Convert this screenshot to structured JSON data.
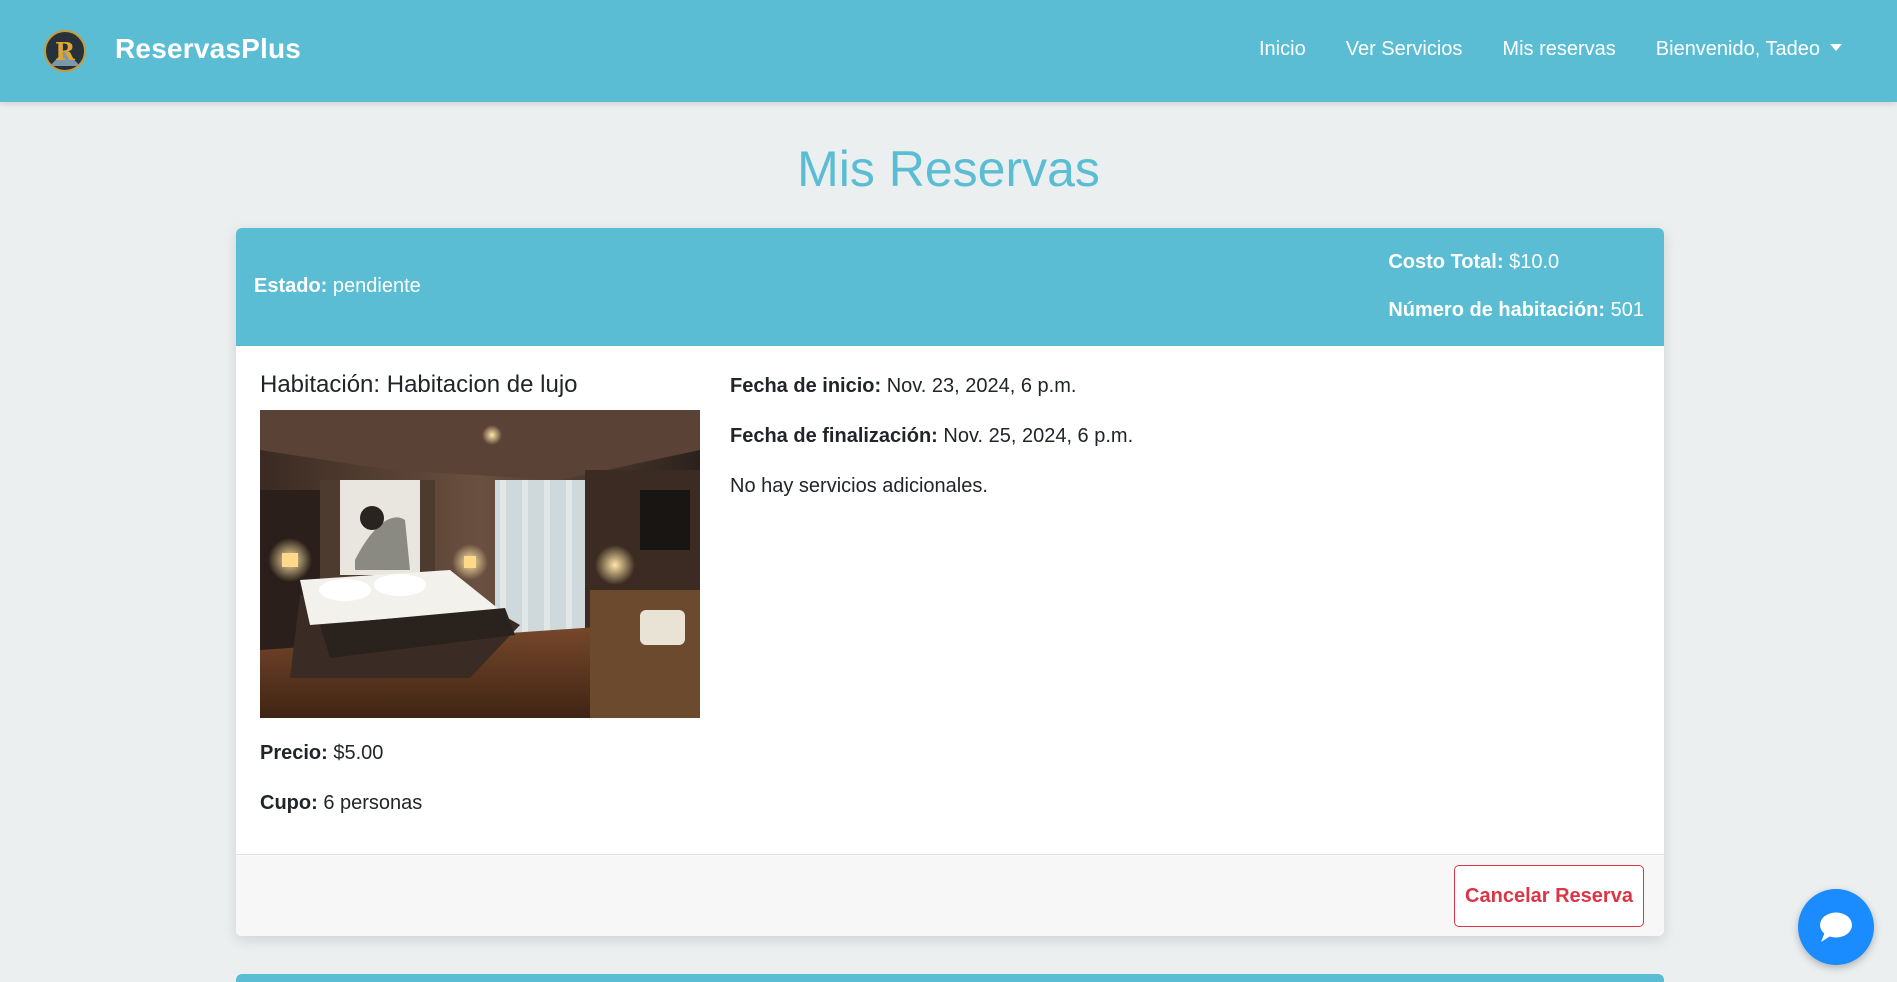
{
  "navbar": {
    "brand": "ReservasPlus",
    "logo_letter": "R",
    "links": [
      "Inicio",
      "Ver Servicios",
      "Mis reservas"
    ],
    "user_menu": "Bienvenido, Tadeo"
  },
  "page": {
    "title": "Mis Reservas"
  },
  "reservation": {
    "status_label": "Estado:",
    "status_value": "pendiente",
    "total_label": "Costo Total:",
    "total_value": "$10.0",
    "room_number_label": "Número de habitación:",
    "room_number_value": "501",
    "room_title": "Habitación: Habitacion de lujo",
    "price_label": "Precio:",
    "price_value": "$5.00",
    "capacity_label": "Cupo:",
    "capacity_value": "6 personas",
    "start_label": "Fecha de inicio:",
    "start_value": "Nov. 23, 2024, 6 p.m.",
    "end_label": "Fecha de finalización:",
    "end_value": "Nov. 25, 2024, 6 p.m.",
    "services_text": "No hay servicios adicionales.",
    "cancel_label": "Cancelar Reserva"
  },
  "icons": {
    "chat": "chat-bubble-icon",
    "caret": "chevron-down-icon",
    "logo": "brand-logo-icon"
  },
  "colors": {
    "primary": "#5bbdd4",
    "danger": "#dc3545",
    "chat": "#1a8cff",
    "background": "#ebeff0"
  }
}
